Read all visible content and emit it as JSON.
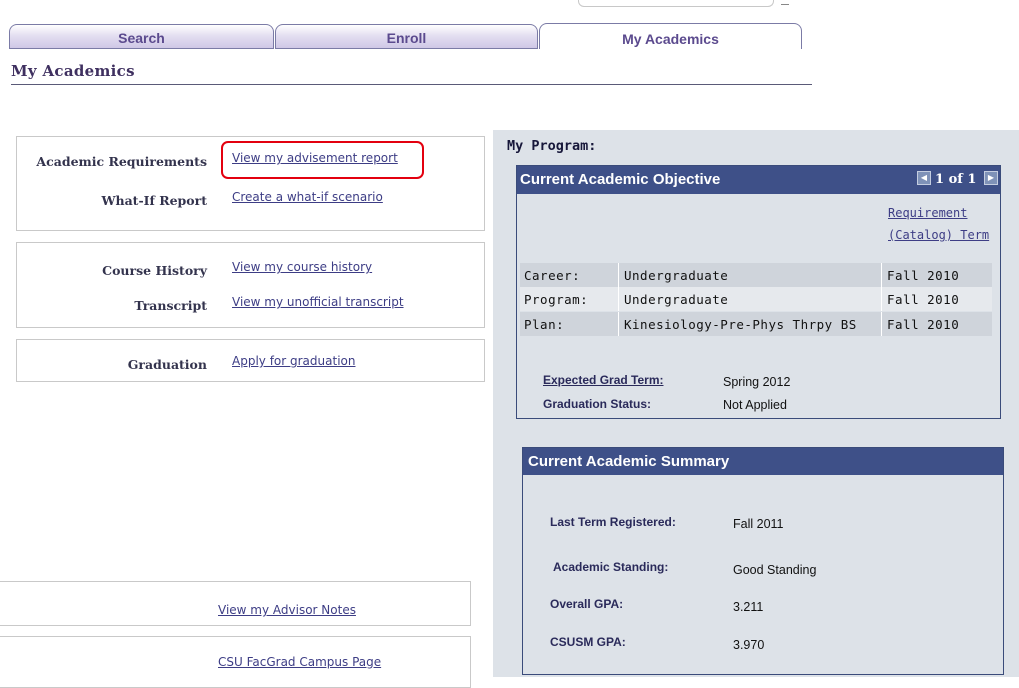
{
  "tabs": [
    {
      "label": "Search"
    },
    {
      "label": "Enroll"
    },
    {
      "label": "My Academics"
    }
  ],
  "page_title": "My Academics",
  "left": {
    "box1": {
      "items": [
        {
          "label": "Academic Requirements",
          "link": "View my advisement report"
        },
        {
          "label": "What-If Report",
          "link": "Create a what-if scenario"
        }
      ]
    },
    "box2": {
      "items": [
        {
          "label": "Course History",
          "link": "View my course history"
        },
        {
          "label": "Transcript",
          "link": "View my unofficial transcript"
        }
      ]
    },
    "box3": {
      "items": [
        {
          "label": "Graduation",
          "link": "Apply for graduation"
        }
      ]
    },
    "advisor_notes_link": "View my Advisor Notes",
    "facgrad_link": "CSU FacGrad Campus Page"
  },
  "program": {
    "heading": "My Program:",
    "objective": {
      "title": "Current Academic Objective",
      "pager": "1 of 1",
      "requirement_link_line1": "Requirement",
      "requirement_link_line2": "(Catalog) Term",
      "rows": [
        {
          "label": "Career:",
          "value": "Undergraduate",
          "term": "Fall 2010"
        },
        {
          "label": "Program:",
          "value": "Undergraduate",
          "term": "Fall 2010"
        },
        {
          "label": "Plan:",
          "value": "Kinesiology-Pre-Phys Thrpy BS",
          "term": "Fall 2010"
        }
      ],
      "expected_grad_label": "Expected Grad Term:",
      "expected_grad_value": "Spring 2012",
      "grad_status_label": "Graduation Status:",
      "grad_status_value": "Not Applied"
    },
    "summary": {
      "title": "Current Academic Summary",
      "last_term_label": "Last Term Registered:",
      "last_term_value": "Fall 2011",
      "standing_label": "Academic Standing:",
      "standing_value": "Good Standing",
      "overall_gpa_label": "Overall GPA:",
      "overall_gpa_value": "3.211",
      "csusm_gpa_label": "CSUSM GPA:",
      "csusm_gpa_value": "3.970"
    }
  },
  "colors": {
    "header_bg": "#3e5088",
    "panel_bg": "#dde2e8",
    "highlight": "#e3000f",
    "link": "#3d3d85"
  }
}
